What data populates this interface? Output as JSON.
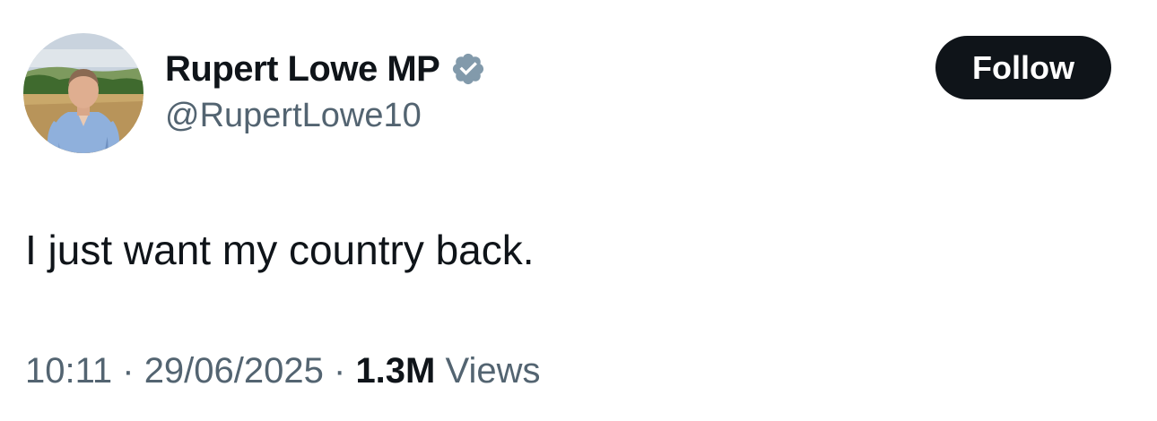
{
  "author": {
    "display_name": "Rupert Lowe MP",
    "handle": "@RupertLowe10",
    "verified": true,
    "verified_badge_icon": "verified-badge-icon",
    "badge_color": "#829aab"
  },
  "follow_button": {
    "label": "Follow",
    "background": "#0f1419",
    "text_color": "#ffffff"
  },
  "tweet": {
    "text": "I just want my country back."
  },
  "meta": {
    "time": "10:11",
    "separator1": " · ",
    "date": "29/06/2025",
    "separator2": " · ",
    "views_count": "1.3M",
    "views_label": " Views"
  }
}
